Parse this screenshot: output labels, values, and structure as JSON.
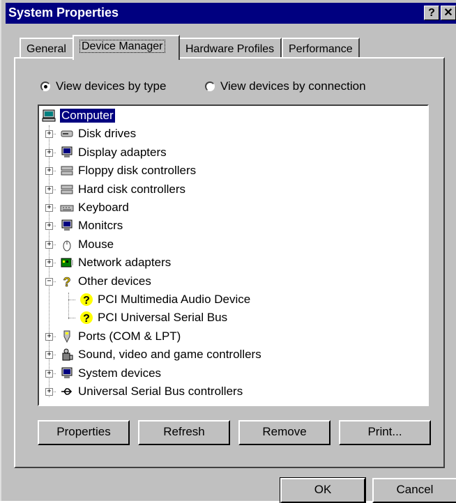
{
  "window": {
    "title": "System Properties",
    "help_label": "?",
    "close_label": "✕"
  },
  "tabs": [
    {
      "label": "General"
    },
    {
      "label": "Device Manager"
    },
    {
      "label": "Hardware Profiles"
    },
    {
      "label": "Performance"
    }
  ],
  "view_options": {
    "by_type": "View devices by type",
    "by_connection": "View devices by connection",
    "selected": "by_type"
  },
  "tree": {
    "root": "Computer",
    "items": [
      {
        "label": "Disk drives",
        "icon": "disk-drive-icon",
        "expander": "+"
      },
      {
        "label": "Display adapters",
        "icon": "monitor-icon",
        "expander": "+"
      },
      {
        "label": "Floppy disk controllers",
        "icon": "controller-icon",
        "expander": "+"
      },
      {
        "label": "Hard cisk controllers",
        "icon": "controller-icon",
        "expander": "+"
      },
      {
        "label": "Keyboard",
        "icon": "keyboard-icon",
        "expander": "+"
      },
      {
        "label": "Monitcrs",
        "icon": "monitor-icon",
        "expander": "+"
      },
      {
        "label": "Mouse",
        "icon": "mouse-icon",
        "expander": "+"
      },
      {
        "label": "Network adapters",
        "icon": "network-card-icon",
        "expander": "+"
      },
      {
        "label": "Other devices",
        "icon": "question-mark-icon",
        "expander": "−",
        "children": [
          {
            "label": "PCI Multimedia Audio Device",
            "icon": "unknown-device-icon"
          },
          {
            "label": "PCI Universal Serial Bus",
            "icon": "unknown-device-icon"
          }
        ]
      },
      {
        "label": "Ports (COM & LPT)",
        "icon": "port-icon",
        "expander": "+"
      },
      {
        "label": "Sound, video and game controllers",
        "icon": "sound-icon",
        "expander": "+"
      },
      {
        "label": "System devices",
        "icon": "monitor-icon",
        "expander": "+"
      },
      {
        "label": "Universal Serial Bus controllers",
        "icon": "usb-icon",
        "expander": "+"
      }
    ]
  },
  "buttons": {
    "properties": "Properties",
    "refresh": "Refresh",
    "remove": "Remove",
    "print": "Print...",
    "ok": "OK",
    "cancel": "Cancel"
  },
  "colors": {
    "title_bar": "#000080",
    "selection": "#000080",
    "face": "#c0c0c0"
  }
}
